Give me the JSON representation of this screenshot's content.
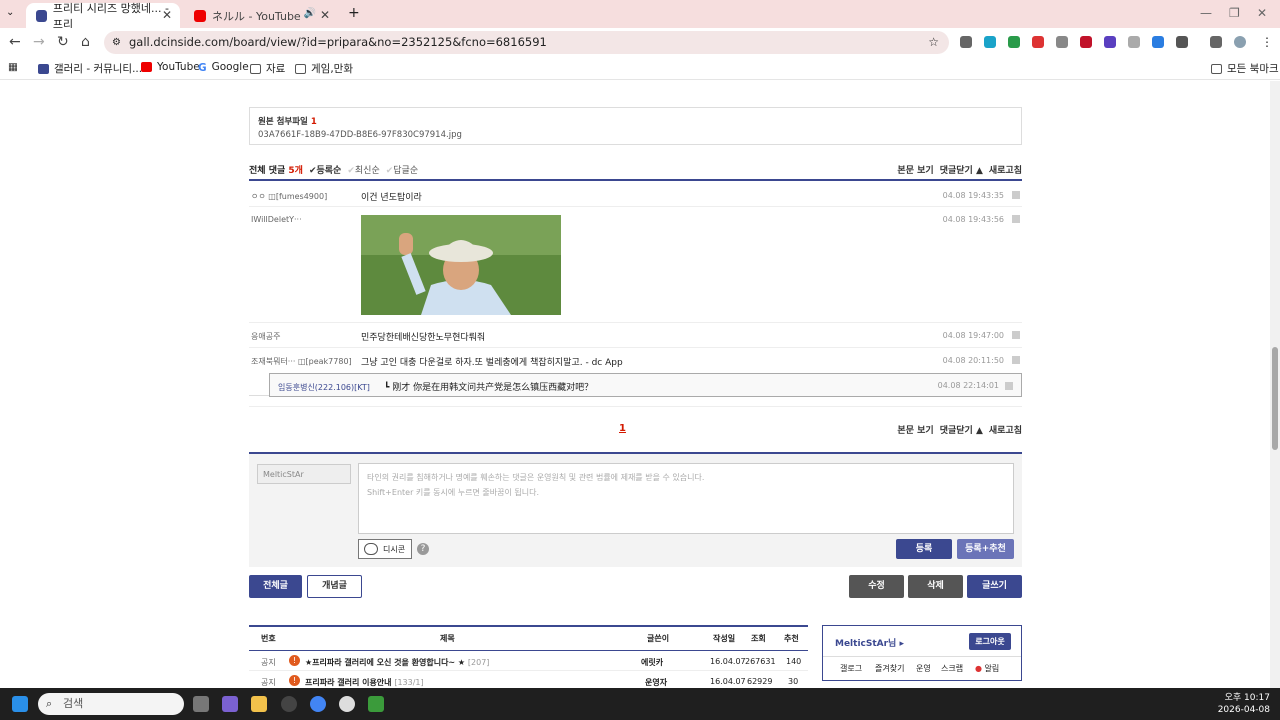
{
  "browser": {
    "tabs": [
      {
        "title": "프리티 시리즈 망했네... - 프리",
        "active": true
      },
      {
        "title": "ネルル - YouTube",
        "active": false
      }
    ],
    "url": "gall.dcinside.com/board/view/?id=pripara&no=2352125&fcno=6816591",
    "bookmarks": [
      "갤러리 - 커뮤니티...",
      "YouTube",
      "Google",
      "자료",
      "게임,만화",
      "모든 북마크"
    ]
  },
  "attachment": {
    "title": "원본 첨부파일",
    "count": "1",
    "filename": "03A7661F-18B9-47DD-B8E6-97F830C97914.jpg"
  },
  "comments_header": {
    "total_label": "전체 댓글",
    "total_count": "5개",
    "sort": [
      "등록순",
      "최신순",
      "답글순"
    ],
    "actions": [
      "본문 보기",
      "댓글닫기 ▲",
      "새로고침"
    ]
  },
  "comments": [
    {
      "nick": "ㅇㅇ ◫[fumes4900]",
      "text": "이건 년도탑이라",
      "date": "04.08 19:43:35"
    },
    {
      "nick": "IWillDeletY···",
      "text": "",
      "date": "04.08 19:43:56"
    },
    {
      "nick": "응애공주",
      "text": "민주당한테배신당한노무현다뤄줘",
      "date": "04.08 19:47:00"
    },
    {
      "nick": "조재북뭐터··· ◫[peak7780]",
      "text": "그냥 고인 대충 다운걸로 하자.또 벌레충에게 책잡히지말고. - dc App",
      "date": "04.08 20:11:50"
    }
  ],
  "reply": {
    "nick": "임동훈병신(222.106)[KT]",
    "text": "刚才 你是在用韩文问共产党是怎么镇压西藏对吧？",
    "date": "04.08 22:14:01"
  },
  "pager": {
    "current": "1"
  },
  "write": {
    "nick": "MelticStAr",
    "placeholder_line1": "타인의 권리를 침해하거나 명예를 훼손하는 댓글은 운영원칙 및 관련 법률에 제재를 받을 수 있습니다.",
    "placeholder_line2": "Shift+Enter 키를 동시에 누르면 줄바꿈이 됩니다.",
    "dccon": "디시콘",
    "submit": "등록",
    "submit_recommend": "등록+추천"
  },
  "board_buttons": {
    "all": "전체글",
    "concept": "개념글",
    "edit": "수정",
    "delete": "삭제",
    "write": "글쓰기"
  },
  "list": {
    "headers": [
      "번호",
      "제목",
      "글쓴이",
      "작성일",
      "조회",
      "추천"
    ],
    "rows": [
      {
        "no": "공지",
        "title": "★프리파라 갤러리에 오신 것을 환영합니다~ ★",
        "reply": "[207]",
        "writer": "에릿카",
        "date": "16.04.07",
        "views": "267631",
        "recommend": "140"
      },
      {
        "no": "공지",
        "title": "프리파라 갤러리 이용안내",
        "reply": "[133/1]",
        "writer": "운영자",
        "date": "16.04.07",
        "views": "62929",
        "recommend": "30"
      }
    ]
  },
  "login_box": {
    "nick": "MelticStAr님",
    "logout": "로그아웃",
    "links": [
      "갤로그",
      "즐겨찾기",
      "운영",
      "스크랩",
      "알림"
    ]
  },
  "taskbar": {
    "search": "검색",
    "time": "오후 10:17",
    "date": "2026-04-08"
  }
}
